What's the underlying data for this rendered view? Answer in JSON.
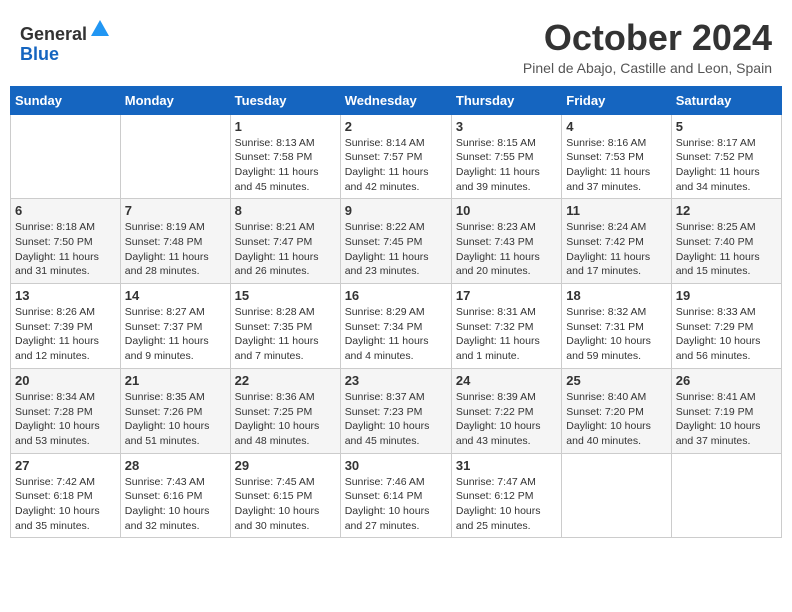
{
  "header": {
    "logo_line1": "General",
    "logo_line2": "Blue",
    "month_title": "October 2024",
    "location": "Pinel de Abajo, Castille and Leon, Spain"
  },
  "days_of_week": [
    "Sunday",
    "Monday",
    "Tuesday",
    "Wednesday",
    "Thursday",
    "Friday",
    "Saturday"
  ],
  "weeks": [
    [
      {
        "day": "",
        "info": ""
      },
      {
        "day": "",
        "info": ""
      },
      {
        "day": "1",
        "info": "Sunrise: 8:13 AM\nSunset: 7:58 PM\nDaylight: 11 hours and 45 minutes."
      },
      {
        "day": "2",
        "info": "Sunrise: 8:14 AM\nSunset: 7:57 PM\nDaylight: 11 hours and 42 minutes."
      },
      {
        "day": "3",
        "info": "Sunrise: 8:15 AM\nSunset: 7:55 PM\nDaylight: 11 hours and 39 minutes."
      },
      {
        "day": "4",
        "info": "Sunrise: 8:16 AM\nSunset: 7:53 PM\nDaylight: 11 hours and 37 minutes."
      },
      {
        "day": "5",
        "info": "Sunrise: 8:17 AM\nSunset: 7:52 PM\nDaylight: 11 hours and 34 minutes."
      }
    ],
    [
      {
        "day": "6",
        "info": "Sunrise: 8:18 AM\nSunset: 7:50 PM\nDaylight: 11 hours and 31 minutes."
      },
      {
        "day": "7",
        "info": "Sunrise: 8:19 AM\nSunset: 7:48 PM\nDaylight: 11 hours and 28 minutes."
      },
      {
        "day": "8",
        "info": "Sunrise: 8:21 AM\nSunset: 7:47 PM\nDaylight: 11 hours and 26 minutes."
      },
      {
        "day": "9",
        "info": "Sunrise: 8:22 AM\nSunset: 7:45 PM\nDaylight: 11 hours and 23 minutes."
      },
      {
        "day": "10",
        "info": "Sunrise: 8:23 AM\nSunset: 7:43 PM\nDaylight: 11 hours and 20 minutes."
      },
      {
        "day": "11",
        "info": "Sunrise: 8:24 AM\nSunset: 7:42 PM\nDaylight: 11 hours and 17 minutes."
      },
      {
        "day": "12",
        "info": "Sunrise: 8:25 AM\nSunset: 7:40 PM\nDaylight: 11 hours and 15 minutes."
      }
    ],
    [
      {
        "day": "13",
        "info": "Sunrise: 8:26 AM\nSunset: 7:39 PM\nDaylight: 11 hours and 12 minutes."
      },
      {
        "day": "14",
        "info": "Sunrise: 8:27 AM\nSunset: 7:37 PM\nDaylight: 11 hours and 9 minutes."
      },
      {
        "day": "15",
        "info": "Sunrise: 8:28 AM\nSunset: 7:35 PM\nDaylight: 11 hours and 7 minutes."
      },
      {
        "day": "16",
        "info": "Sunrise: 8:29 AM\nSunset: 7:34 PM\nDaylight: 11 hours and 4 minutes."
      },
      {
        "day": "17",
        "info": "Sunrise: 8:31 AM\nSunset: 7:32 PM\nDaylight: 11 hours and 1 minute."
      },
      {
        "day": "18",
        "info": "Sunrise: 8:32 AM\nSunset: 7:31 PM\nDaylight: 10 hours and 59 minutes."
      },
      {
        "day": "19",
        "info": "Sunrise: 8:33 AM\nSunset: 7:29 PM\nDaylight: 10 hours and 56 minutes."
      }
    ],
    [
      {
        "day": "20",
        "info": "Sunrise: 8:34 AM\nSunset: 7:28 PM\nDaylight: 10 hours and 53 minutes."
      },
      {
        "day": "21",
        "info": "Sunrise: 8:35 AM\nSunset: 7:26 PM\nDaylight: 10 hours and 51 minutes."
      },
      {
        "day": "22",
        "info": "Sunrise: 8:36 AM\nSunset: 7:25 PM\nDaylight: 10 hours and 48 minutes."
      },
      {
        "day": "23",
        "info": "Sunrise: 8:37 AM\nSunset: 7:23 PM\nDaylight: 10 hours and 45 minutes."
      },
      {
        "day": "24",
        "info": "Sunrise: 8:39 AM\nSunset: 7:22 PM\nDaylight: 10 hours and 43 minutes."
      },
      {
        "day": "25",
        "info": "Sunrise: 8:40 AM\nSunset: 7:20 PM\nDaylight: 10 hours and 40 minutes."
      },
      {
        "day": "26",
        "info": "Sunrise: 8:41 AM\nSunset: 7:19 PM\nDaylight: 10 hours and 37 minutes."
      }
    ],
    [
      {
        "day": "27",
        "info": "Sunrise: 7:42 AM\nSunset: 6:18 PM\nDaylight: 10 hours and 35 minutes."
      },
      {
        "day": "28",
        "info": "Sunrise: 7:43 AM\nSunset: 6:16 PM\nDaylight: 10 hours and 32 minutes."
      },
      {
        "day": "29",
        "info": "Sunrise: 7:45 AM\nSunset: 6:15 PM\nDaylight: 10 hours and 30 minutes."
      },
      {
        "day": "30",
        "info": "Sunrise: 7:46 AM\nSunset: 6:14 PM\nDaylight: 10 hours and 27 minutes."
      },
      {
        "day": "31",
        "info": "Sunrise: 7:47 AM\nSunset: 6:12 PM\nDaylight: 10 hours and 25 minutes."
      },
      {
        "day": "",
        "info": ""
      },
      {
        "day": "",
        "info": ""
      }
    ]
  ]
}
